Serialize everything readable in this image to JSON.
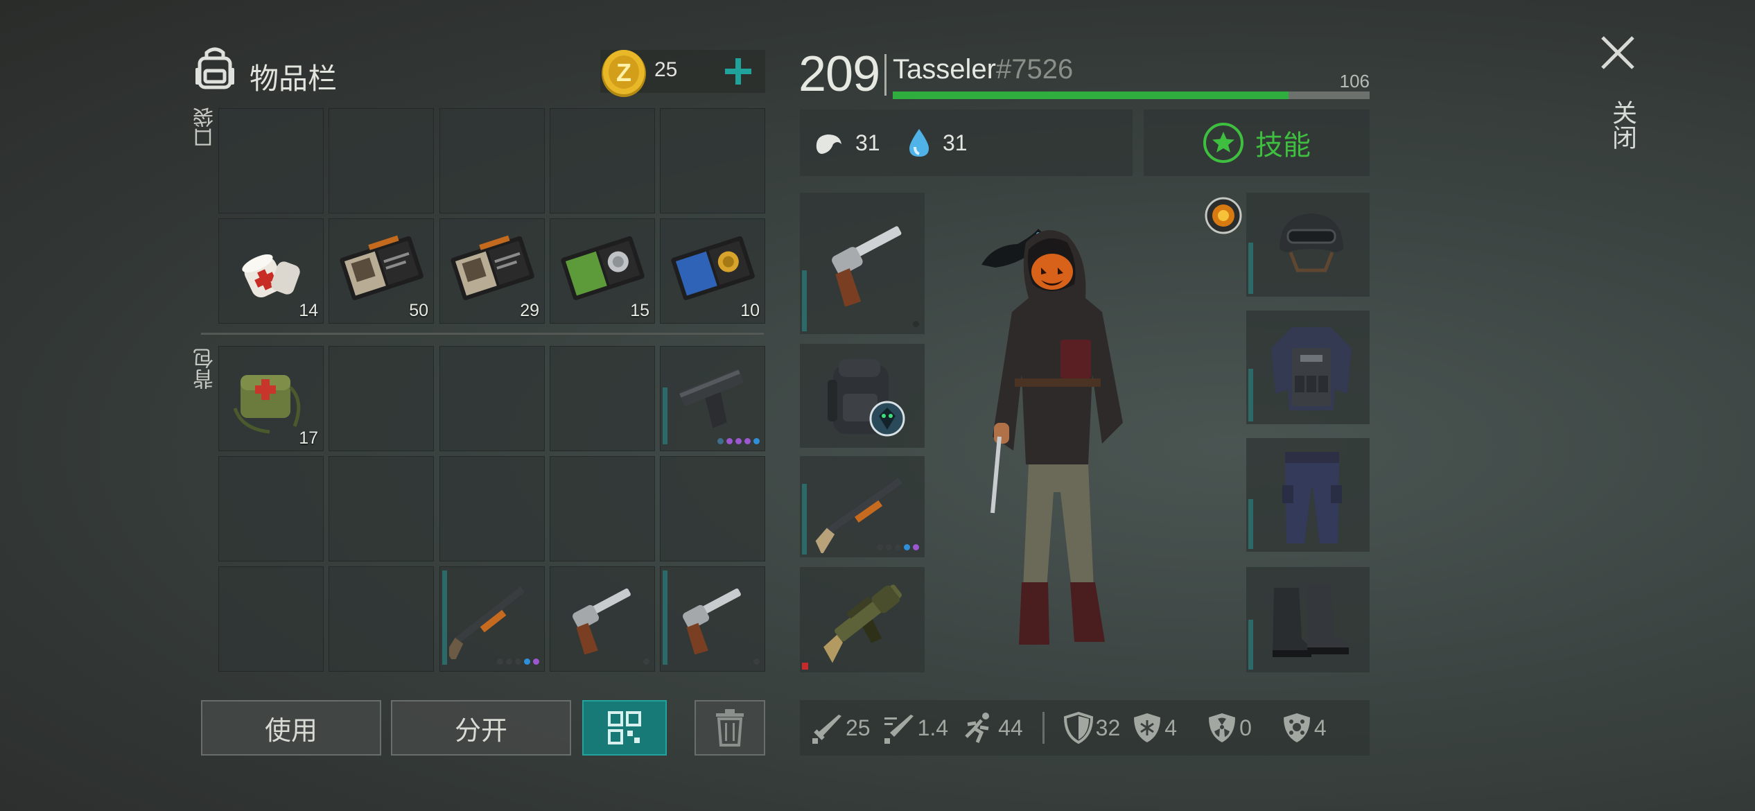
{
  "inventory": {
    "title": "物品栏",
    "coin_count": "25",
    "coin_letter": "Z",
    "pocket_label": "口袋",
    "backpack_label": "背包",
    "pocket_items": [
      {
        "qty": "14",
        "icon": "bandage-icon"
      },
      {
        "qty": "50",
        "icon": "patrol-officer-id-icon"
      },
      {
        "qty": "29",
        "icon": "patrol-officer-id-icon"
      },
      {
        "qty": "15",
        "icon": "silver-badge-id-icon"
      },
      {
        "qty": "10",
        "icon": "gold-badge-id-icon"
      }
    ],
    "backpack_items": [
      {
        "qty": "17",
        "icon": "medkit-bag-icon"
      }
    ]
  },
  "buttons": {
    "use": "使用",
    "split": "分开"
  },
  "player": {
    "level": "209",
    "name": "Tasseler",
    "tag": "#7526",
    "xp_value": "106",
    "xp_fraction": 0.83,
    "hunger": "31",
    "thirst": "31",
    "skills_label": "技能"
  },
  "stats": {
    "attack": "25",
    "attack_speed": "1.4",
    "speed": "44",
    "defense": "32",
    "cold": "4",
    "radiation": "0",
    "infection": "4"
  },
  "close_label": "关闭",
  "colors": {
    "accent": "#3fbf3f",
    "teal": "#1f8a86",
    "xp": "#2fae3f",
    "bg": "#383f3d"
  }
}
